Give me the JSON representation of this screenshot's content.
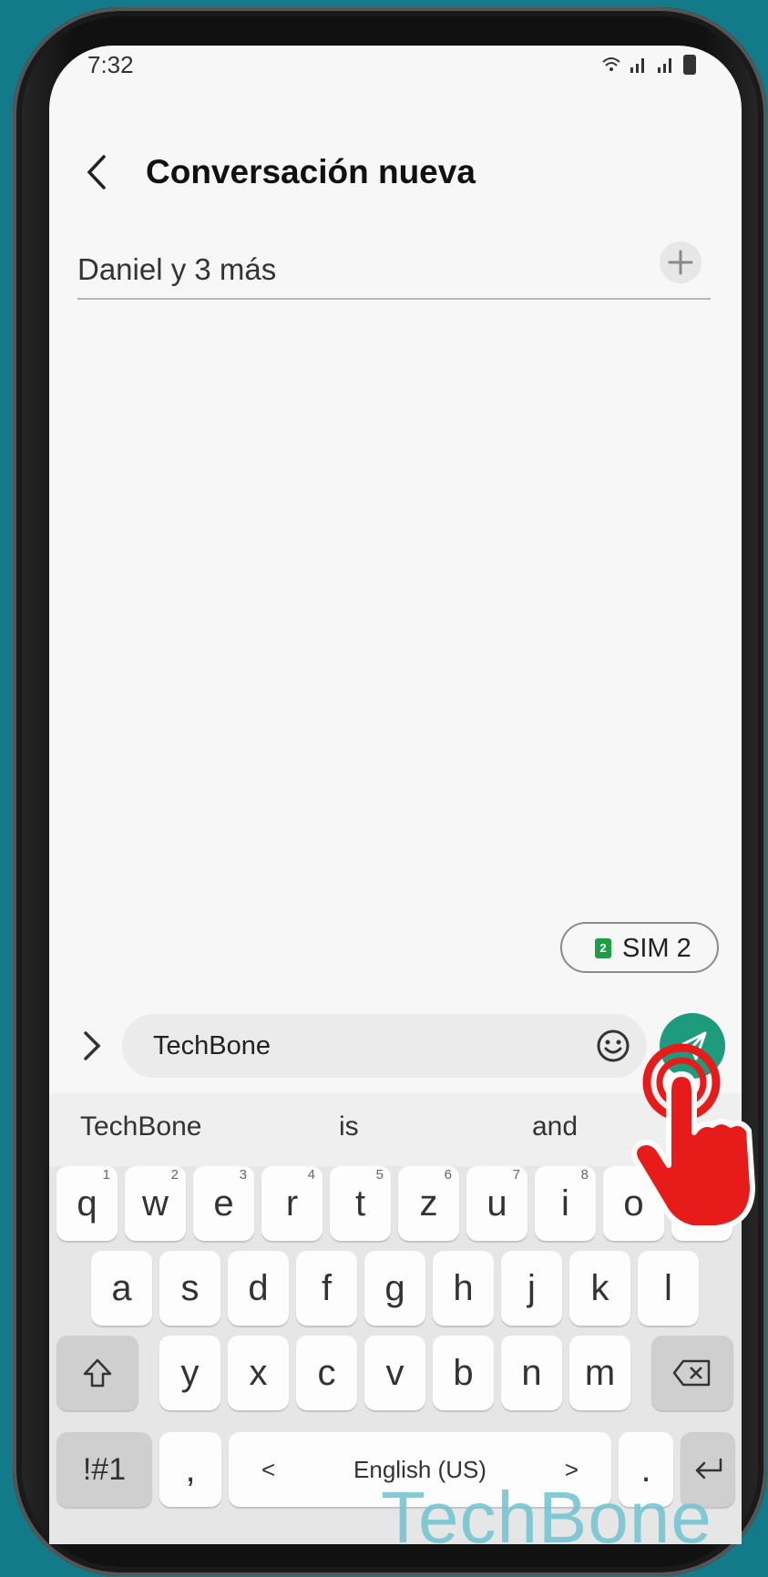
{
  "status": {
    "time": "7:32"
  },
  "header": {
    "title": "Conversación nueva"
  },
  "recipients": {
    "value": "Daniel y 3 más"
  },
  "sim": {
    "label": "SIM 2",
    "badge": "2"
  },
  "compose": {
    "message": "TechBone"
  },
  "suggestions": [
    "TechBone",
    "is",
    "and"
  ],
  "keyboard": {
    "row1": [
      {
        "k": "q",
        "h": "1"
      },
      {
        "k": "w",
        "h": "2"
      },
      {
        "k": "e",
        "h": "3"
      },
      {
        "k": "r",
        "h": "4"
      },
      {
        "k": "t",
        "h": "5"
      },
      {
        "k": "z",
        "h": "6"
      },
      {
        "k": "u",
        "h": "7"
      },
      {
        "k": "i",
        "h": "8"
      },
      {
        "k": "o",
        "h": "9"
      },
      {
        "k": "p",
        "h": "0"
      }
    ],
    "row2": [
      "a",
      "s",
      "d",
      "f",
      "g",
      "h",
      "j",
      "k",
      "l"
    ],
    "row3": [
      "y",
      "x",
      "c",
      "v",
      "b",
      "n",
      "m"
    ],
    "symbols_label": "!#1",
    "comma_label": ",",
    "space_label": "English (US)",
    "left_arrow": "<",
    "right_arrow": ">",
    "period_label": "."
  },
  "watermark": "TechBone",
  "colors": {
    "accent": "#1d9b7c",
    "background": "#137a8a",
    "sim_badge": "#1a9e46",
    "tap_hand": "#e81b1b"
  },
  "icons": [
    "back-icon",
    "add-icon",
    "sim-icon",
    "expand-icon",
    "emoji-icon",
    "send-icon",
    "shift-icon",
    "backspace-icon",
    "enter-icon",
    "tap-hand-icon"
  ]
}
